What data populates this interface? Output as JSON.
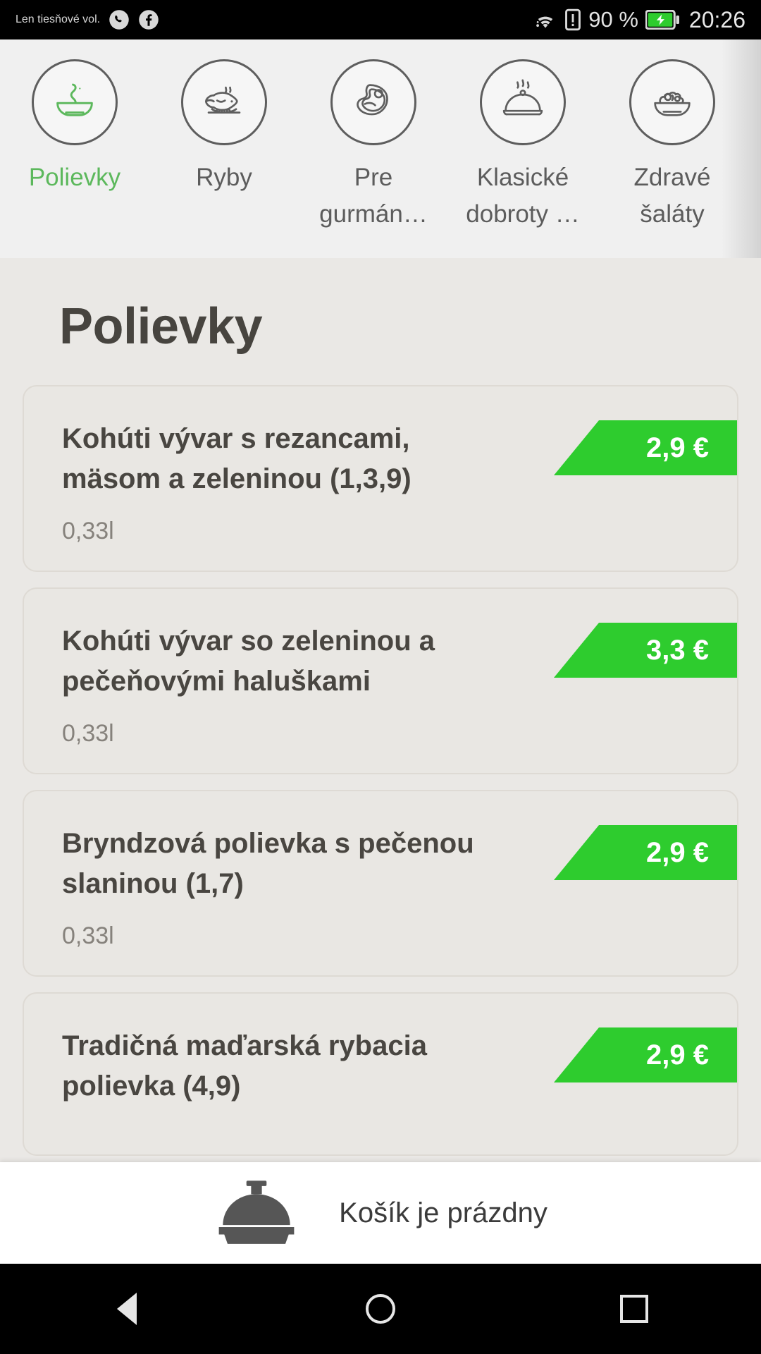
{
  "status_bar": {
    "carrier_text": "Len tiesňové vol.",
    "phone_icon": "phone-circle-icon",
    "facebook_icon": "facebook-icon",
    "wifi_icon": "wifi-icon",
    "sim_icon": "sim-alert-icon",
    "battery_percent": "90 %",
    "battery_icon": "battery-charging-icon",
    "clock": "20:26"
  },
  "tabs": [
    {
      "label": "Polievky",
      "icon": "soup-bowl-icon",
      "active": true
    },
    {
      "label": "Ryby",
      "icon": "fish-plate-icon",
      "active": false
    },
    {
      "label": "Pre gurmán…",
      "icon": "steak-icon",
      "active": false
    },
    {
      "label": "Klasické dobroty …",
      "icon": "cloche-icon",
      "active": false
    },
    {
      "label": "Zdravé šaláty",
      "icon": "salad-bowl-icon",
      "active": false
    }
  ],
  "main": {
    "title": "Polievky",
    "items": [
      {
        "name": "Kohúti vývar s rezancami, mäsom a zeleninou (1,3,9)",
        "portion": "0,33l",
        "price": "2,9 €"
      },
      {
        "name": "Kohúti vývar so zeleninou a pečeňovými haluškami",
        "portion": "0,33l",
        "price": "3,3 €"
      },
      {
        "name": "Bryndzová polievka s pečenou slaninou (1,7)",
        "portion": "0,33l",
        "price": "2,9 €"
      },
      {
        "name": "Tradičná maďarská rybacia polievka (4,9)",
        "portion": "",
        "price": "2,9 €"
      }
    ]
  },
  "cart_bar": {
    "icon": "cloche-icon",
    "text": "Košík je prázdny"
  },
  "nav_bar": {
    "back": "back-icon",
    "home": "home-icon",
    "recents": "recents-icon"
  },
  "colors": {
    "accent_green": "#2ecc2e",
    "active_tab_text": "#5cb85c",
    "content_bg": "#eae8e5",
    "card_bg": "#e9e7e3"
  }
}
